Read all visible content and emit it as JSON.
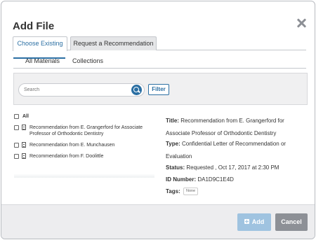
{
  "modal": {
    "title": "Add File"
  },
  "tabs": [
    {
      "label": "Choose Existing",
      "active": true
    },
    {
      "label": "Request a Recommendation",
      "active": false
    }
  ],
  "subtabs": [
    {
      "label": "All Materials",
      "active": true
    },
    {
      "label": "Collections",
      "active": false
    }
  ],
  "search": {
    "placeholder": "Search",
    "filter_label": "Filter"
  },
  "list": {
    "all_label": "All",
    "items": [
      {
        "label": "Recommendation from E. Grangerford for Associate Professor of Orthodontic Dentistry"
      },
      {
        "label": "Recommendation from E. Munchausen"
      },
      {
        "label": "Recommendation from F. Doolittle"
      }
    ]
  },
  "details": {
    "title_label": "Title:",
    "title_value": "Recommendation from E. Grangerford for Associate Professor of Orthodontic Dentistry",
    "type_label": "Type:",
    "type_value": "Confidential Letter of Recommendation or Evaluation",
    "status_label": "Status:",
    "status_value": "Requested , Oct 17, 2017 at 2:30 PM",
    "id_label": "ID Number:",
    "id_value": "DA1D9C1E4D",
    "tags_label": "Tags:",
    "tags_value": "None"
  },
  "footer": {
    "add_label": "Add",
    "cancel_label": "Cancel"
  },
  "colors": {
    "accent": "#2b6fa3",
    "add_button": "#9fc3e0",
    "cancel_button": "#8d9096"
  }
}
